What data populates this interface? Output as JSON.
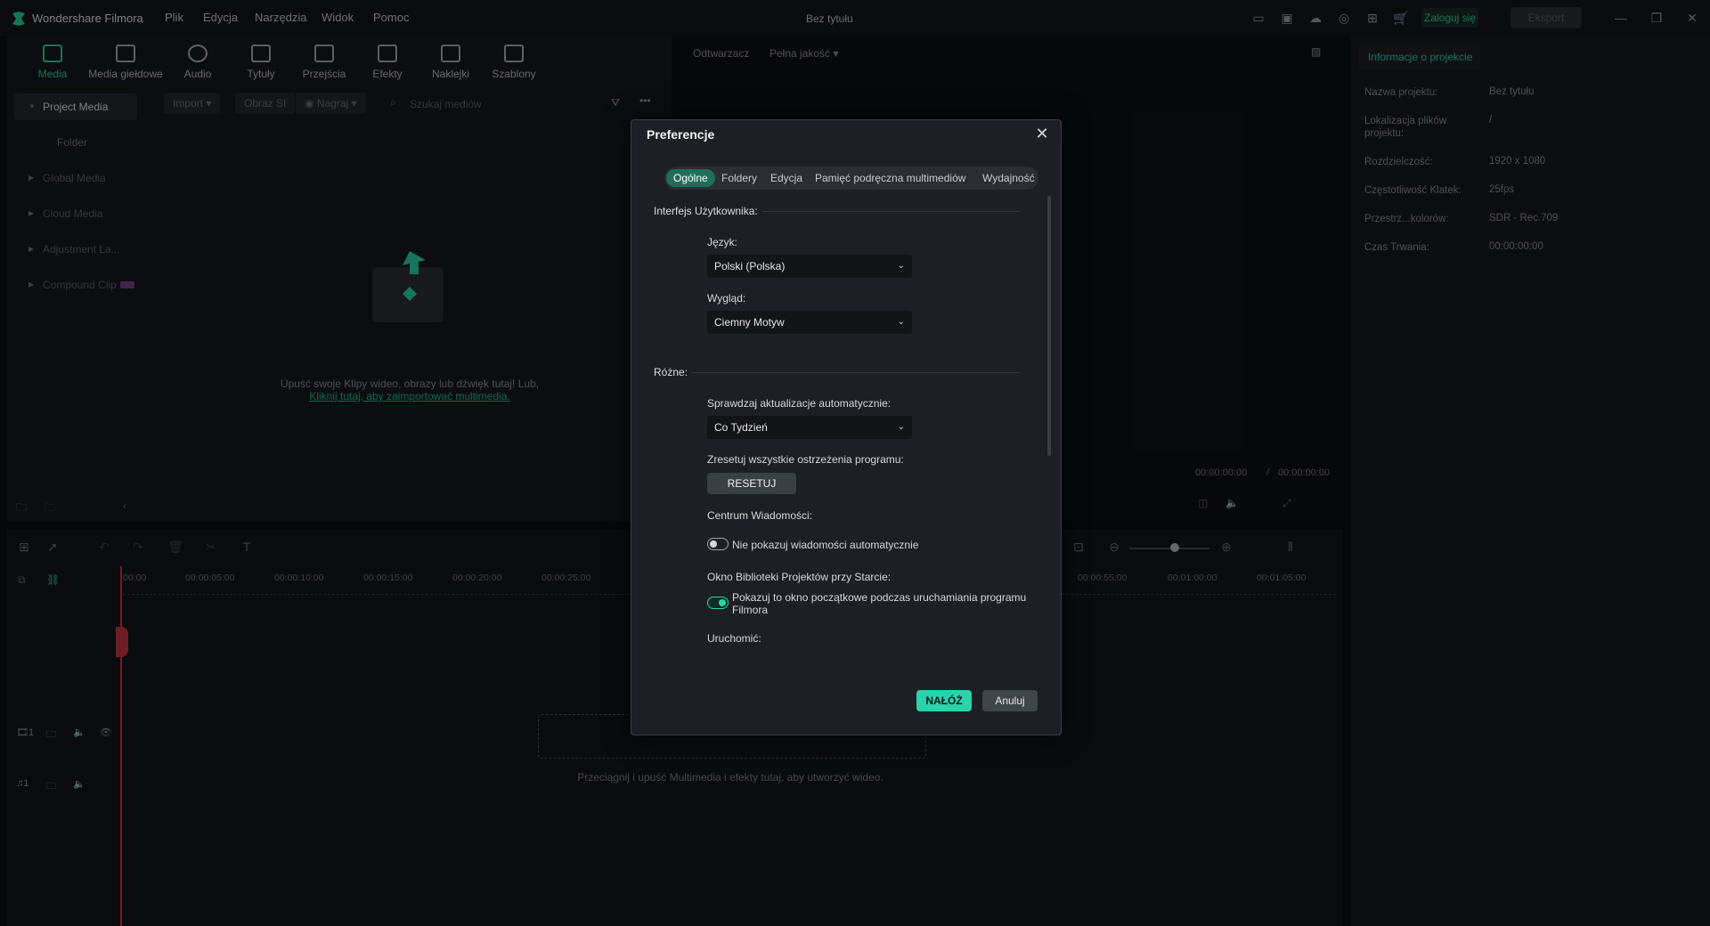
{
  "titlebar": {
    "app_name": "Wondershare Filmora",
    "menus": [
      "Plik",
      "Edycja",
      "Narzędzia",
      "Widok",
      "Pomoc"
    ],
    "doc_title": "Bez tytułu",
    "login": "Zaloguj się",
    "export": "Eksport"
  },
  "toolbar": {
    "tabs": [
      "Media",
      "Media giełdowe",
      "Audio",
      "Tytuły",
      "Przejścia",
      "Efekty",
      "Naklejki",
      "Szablony"
    ]
  },
  "leftnav": {
    "items": [
      "Project Media",
      "Folder",
      "Global Media",
      "Cloud Media",
      "Adjustment La...",
      "Compound Clip"
    ]
  },
  "mediabar": {
    "import": "Import",
    "image": "Obraz SI",
    "record": "Nagraj",
    "search_placeholder": "Szukaj mediów"
  },
  "dropzone": {
    "line1": "Upuść swoje Klipy wideo, obrazy lub dźwięk tutaj! Lub,",
    "link": "Kliknij tutaj, aby zaimportować multimedia."
  },
  "player": {
    "label": "Odtwarzacz",
    "quality": "Pełna jakość",
    "time_current": "00:00:00:00",
    "time_sep": "/",
    "time_total": "00:00:00:00"
  },
  "project_info": {
    "tab": "Informacje o projekcie",
    "rows": [
      {
        "label": "Nazwa projektu:",
        "value": "Bez tytułu"
      },
      {
        "label": "Lokalizacja plików projektu:",
        "value": "/"
      },
      {
        "label": "Rozdzielczość:",
        "value": "1920 x 1080"
      },
      {
        "label": "Częstotliwość Klatek:",
        "value": "25fps"
      },
      {
        "label": "Przestrz...kolorów:",
        "value": "SDR - Rec.709"
      },
      {
        "label": "Czas Trwania:",
        "value": "00:00:00:00"
      }
    ]
  },
  "timeline": {
    "ruler": [
      "00:00",
      "00:00:05:00",
      "00:00:10:00",
      "00:00:15:00",
      "00:00:20:00",
      "00:00:25:00",
      "00:00:55:00",
      "00:01:00:00",
      "00:01:05:00"
    ],
    "hint": "Przeciągnij i upuść Multimedia i efekty tutaj, aby utworzyć wideo."
  },
  "dialog": {
    "title": "Preferencje",
    "tabs": [
      "Ogólne",
      "Foldery",
      "Edycja",
      "Pamięć podręczna multimediów",
      "Wydajność"
    ],
    "section_ui": "Interfejs Użytkownika:",
    "language_label": "Język:",
    "language_value": "Polski (Polska)",
    "appearance_label": "Wygląd:",
    "appearance_value": "Ciemny Motyw",
    "section_misc": "Różne:",
    "updates_label": "Sprawdzaj aktualizacje automatycznie:",
    "updates_value": "Co Tydzień",
    "reset_label": "Zresetuj wszystkie ostrzeżenia programu:",
    "reset_button": "RESETUJ",
    "messages_label": "Centrum Wiadomości:",
    "messages_toggle": "Nie pokazuj wiadomości automatycznie",
    "library_label": "Okno Biblioteki Projektów przy Starcie:",
    "library_toggle": "Pokazuj to okno początkowe podczas uruchamiania programu Filmora",
    "launch_label": "Uruchomić:",
    "apply": "NAŁÓŻ",
    "cancel": "Anuluj"
  },
  "colors": {
    "accent": "#2ad4aa",
    "background": "#0b0d10",
    "panel": "#15181b",
    "dialog": "#1c1f23"
  }
}
